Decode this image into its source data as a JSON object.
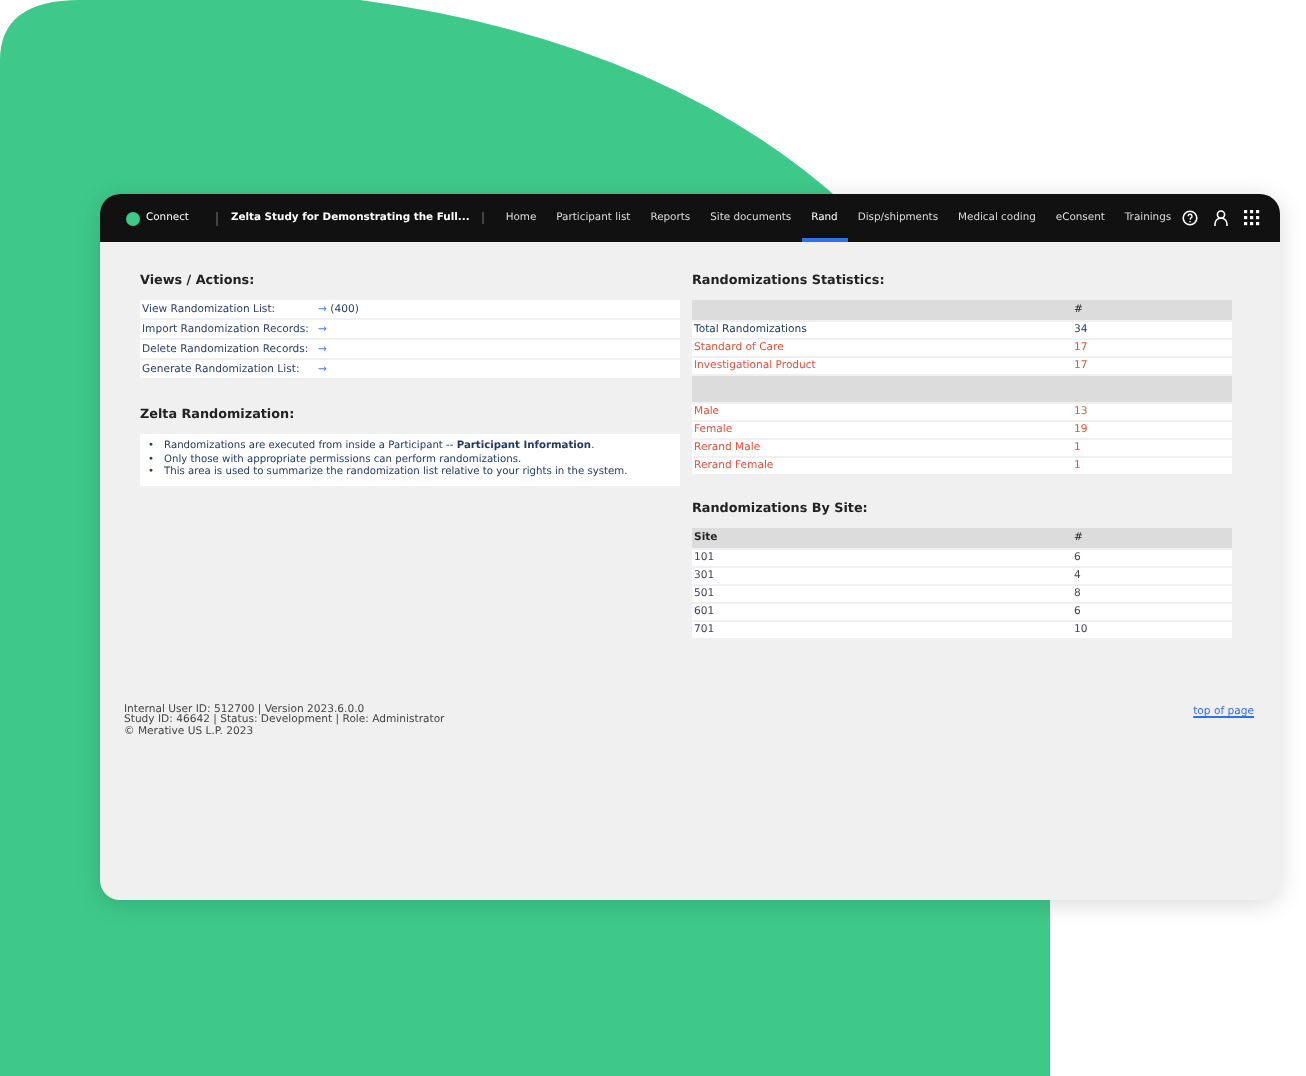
{
  "nav": {
    "brand": "Connect",
    "study": "Zelta Study for Demonstrating the Full...",
    "tabs": [
      {
        "label": "Home",
        "selected": false
      },
      {
        "label": "Participant list",
        "selected": false
      },
      {
        "label": "Reports",
        "selected": false
      },
      {
        "label": "Site documents",
        "selected": false
      },
      {
        "label": "Rand",
        "selected": true
      },
      {
        "label": "Disp/shipments",
        "selected": false
      },
      {
        "label": "Medical coding",
        "selected": false
      },
      {
        "label": "eConsent",
        "selected": false
      },
      {
        "label": "Trainings",
        "selected": false
      }
    ]
  },
  "views": {
    "title": "Views / Actions:",
    "rows": [
      {
        "label": "View Randomization List:",
        "arrow": "→",
        "count": "(400)"
      },
      {
        "label": "Import Randomization Records:",
        "arrow": "→"
      },
      {
        "label": "Delete Randomization Records:",
        "arrow": "→"
      },
      {
        "label": "Generate Randomization List:",
        "arrow": "→"
      }
    ]
  },
  "zelta": {
    "title": "Zelta Randomization:",
    "items": [
      {
        "bullet": "•",
        "text": "Randomizations are executed from inside a Participant -- **Participant Information**."
      },
      {
        "bullet": "•",
        "text": "Only those with appropriate permissions can perform randomizations."
      },
      {
        "bullet": "•",
        "text": "This area is used to summarize the randomization list relative to your rights in the system."
      }
    ]
  },
  "stats": {
    "title": "Randomizations Statistics:",
    "rows": [
      {
        "kind": "header",
        "label": "",
        "value": "#"
      },
      {
        "kind": "row",
        "label": "Total Randomizations",
        "value": "34",
        "color": "#233a64"
      },
      {
        "kind": "row",
        "label": "Standard of Care",
        "value": "17",
        "color": "#e0533a"
      },
      {
        "kind": "row",
        "label": "Investigational Product",
        "value": "17",
        "color": "#e0533a"
      },
      {
        "kind": "spacer"
      },
      {
        "kind": "row",
        "label": "Male",
        "value": "13",
        "color": "#e0533a"
      },
      {
        "kind": "row",
        "label": "Female",
        "value": "19",
        "color": "#e0533a"
      },
      {
        "kind": "row",
        "label": "Rerand Male",
        "value": "1",
        "color": "#e0533a"
      },
      {
        "kind": "row",
        "label": "Rerand Female",
        "value": "1",
        "color": "#e0533a"
      }
    ]
  },
  "sites": {
    "title": "Randomizations By Site:",
    "columns": [
      "Site",
      "#"
    ],
    "rows": [
      [
        "101",
        "6"
      ],
      [
        "301",
        "4"
      ],
      [
        "501",
        "8"
      ],
      [
        "601",
        "6"
      ],
      [
        "701",
        "10"
      ]
    ]
  },
  "footer": {
    "lines": [
      "Internal User ID: 512700 | Version 2023.6.0.0",
      "Study ID: 46642 | Status: Development | Role: Administrator",
      "© Merative US L.P. 2023"
    ],
    "link": "top of page"
  }
}
